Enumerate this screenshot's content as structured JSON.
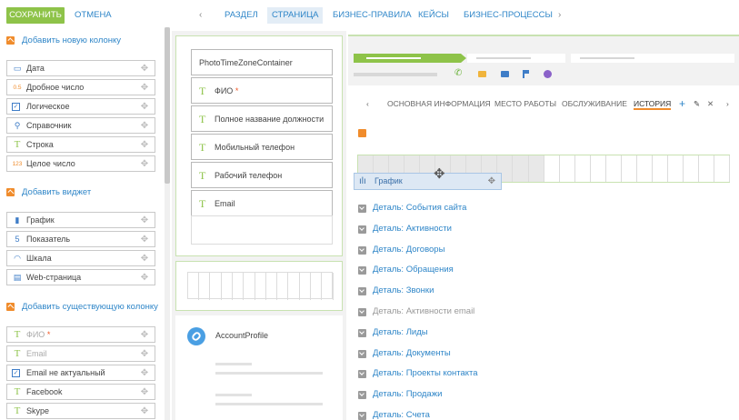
{
  "toolbar": {
    "save_label": "СОХРАНИТЬ",
    "cancel_label": "ОТМЕНА",
    "prev_arrow": "‹",
    "next_arrow": "›"
  },
  "top_tabs": [
    {
      "label": "РАЗДЕЛ",
      "active": false
    },
    {
      "label": "СТРАНИЦА",
      "active": true
    },
    {
      "label": "БИЗНЕС-ПРАВИЛА",
      "active": false
    },
    {
      "label": "КЕЙСЫ",
      "active": false
    },
    {
      "label": "БИЗНЕС-ПРОЦЕССЫ",
      "active": false
    }
  ],
  "left_panel": {
    "add_column_label": "Добавить новую колонку",
    "new_columns": [
      {
        "icon": "calendar-icon",
        "glyph": "▭",
        "label": "Дата"
      },
      {
        "icon": "decimal-icon",
        "glyph": "0.5",
        "label": "Дробное число"
      },
      {
        "icon": "checkbox-icon",
        "glyph": "✓",
        "label": "Логическое"
      },
      {
        "icon": "lookup-icon",
        "glyph": "⚲",
        "label": "Справочник"
      },
      {
        "icon": "text-icon",
        "glyph": "T",
        "label": "Строка"
      },
      {
        "icon": "integer-icon",
        "glyph": "123",
        "label": "Целое число"
      }
    ],
    "add_widget_label": "Добавить виджет",
    "widgets": [
      {
        "icon": "chart-icon",
        "glyph": "▮",
        "label": "График"
      },
      {
        "icon": "indicator-icon",
        "glyph": "5",
        "label": "Показатель"
      },
      {
        "icon": "gauge-icon",
        "glyph": "◠",
        "label": "Шкала"
      },
      {
        "icon": "web-page-icon",
        "glyph": "▤",
        "label": "Web-страница"
      }
    ],
    "add_existing_label": "Добавить существующую колонку",
    "existing_columns": [
      {
        "icon": "text-icon",
        "glyph": "T",
        "label": "ФИО",
        "required": true,
        "muted": true
      },
      {
        "icon": "text-icon",
        "glyph": "T",
        "label": "Email",
        "required": false,
        "muted": true
      },
      {
        "icon": "checkbox-icon",
        "glyph": "✓",
        "label": "Email не актуальный",
        "required": false,
        "muted": false
      },
      {
        "icon": "text-icon",
        "glyph": "T",
        "label": "Facebook",
        "required": false,
        "muted": false
      },
      {
        "icon": "text-icon",
        "glyph": "T",
        "label": "Skype",
        "required": false,
        "muted": false
      }
    ],
    "drag_glyph": "✥"
  },
  "middle": {
    "fields": [
      {
        "type": "plain",
        "label": "PhotoTimeZoneContainer"
      },
      {
        "type": "text",
        "glyph": "T",
        "label": "ФИО",
        "required": true
      },
      {
        "type": "text",
        "glyph": "T",
        "label": "Полное название должности"
      },
      {
        "type": "text",
        "glyph": "T",
        "label": "Мобильный телефон"
      },
      {
        "type": "text",
        "glyph": "T",
        "label": "Рабочий телефон"
      },
      {
        "type": "text",
        "glyph": "T",
        "label": "Email"
      }
    ],
    "account_profile_label": "AccountProfile",
    "required_mark": "*"
  },
  "right": {
    "tabs": [
      {
        "label": "ОСНОВНАЯ ИНФОРМАЦИЯ",
        "active": false
      },
      {
        "label": "МЕСТО РАБОТЫ",
        "active": false
      },
      {
        "label": "ОБСЛУЖИВАНИЕ",
        "active": false
      },
      {
        "label": "ИСТОРИЯ",
        "active": true
      }
    ],
    "tab_actions": {
      "add": "+",
      "edit": "✎",
      "remove": "✕",
      "prev": "‹",
      "next": "›"
    },
    "dragged_widget_label": "График",
    "details": [
      {
        "label": "Деталь: События сайта",
        "muted": false
      },
      {
        "label": "Деталь: Активности",
        "muted": false
      },
      {
        "label": "Деталь: Договоры",
        "muted": false
      },
      {
        "label": "Деталь: Обращения",
        "muted": false
      },
      {
        "label": "Деталь: Звонки",
        "muted": false
      },
      {
        "label": "Деталь: Активности email",
        "muted": true
      },
      {
        "label": "Деталь: Лиды",
        "muted": false
      },
      {
        "label": "Деталь: Документы",
        "muted": false
      },
      {
        "label": "Деталь: Проекты контакта",
        "muted": false
      },
      {
        "label": "Деталь: Продажи",
        "muted": false
      },
      {
        "label": "Деталь: Счета",
        "muted": false
      }
    ]
  },
  "colors": {
    "accent_green": "#8ec349",
    "link_blue": "#2f86c8",
    "orange": "#f08c2c",
    "required_red": "#f05a28"
  }
}
